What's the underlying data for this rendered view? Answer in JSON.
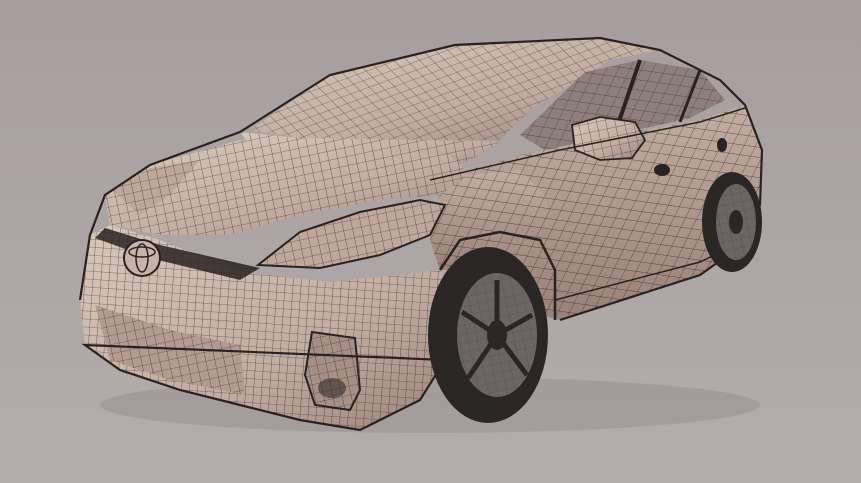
{
  "scene": {
    "subject_icon": "car-wireframe-icon",
    "colors": {
      "background_top": "#a89d9e",
      "background_mid": "#aea6a6",
      "background_bottom": "#b2adaa",
      "body_light": "#d9c7bb",
      "body_mid": "#c3ada2",
      "body_dark": "#9a8178",
      "wire": "#2a2222",
      "glass": "#8e7f7c",
      "tire": "#2b2626",
      "rim": "#6d6563"
    }
  }
}
